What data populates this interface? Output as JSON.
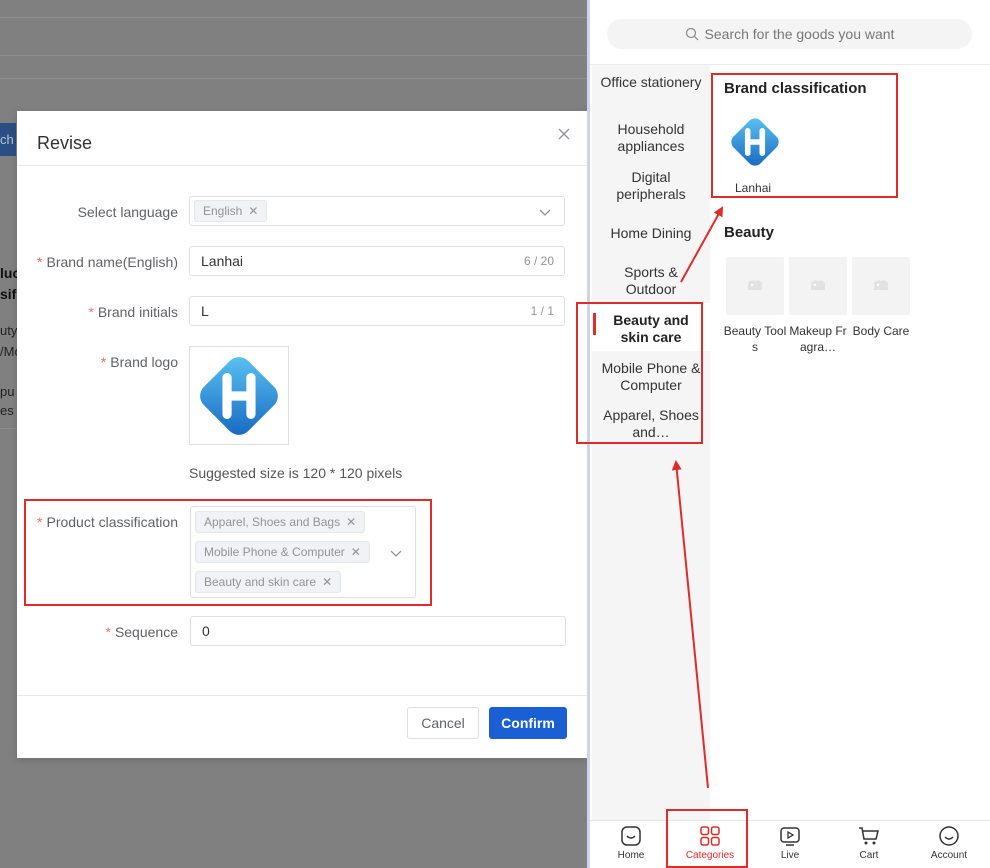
{
  "modal": {
    "title": "Revise",
    "language": {
      "label": "Select language",
      "tag": "English"
    },
    "brand_name": {
      "label": "Brand name(English)",
      "value": "Lanhai",
      "count": "6 / 20"
    },
    "brand_initials": {
      "label": "Brand initials",
      "value": "L",
      "count": "1 / 1"
    },
    "brand_logo": {
      "label": "Brand logo",
      "hint": "Suggested size is 120 * 120 pixels"
    },
    "product_classification": {
      "label": "Product classification",
      "tags": [
        "Apparel, Shoes and Bags",
        "Mobile Phone & Computer",
        "Beauty and skin care"
      ]
    },
    "sequence": {
      "label": "Sequence",
      "value": "0"
    },
    "buttons": {
      "cancel": "Cancel",
      "confirm": "Confirm"
    }
  },
  "backdrop": {
    "search_fragment": "ch",
    "fragments": [
      "luc",
      "sifi",
      "uty",
      "/Mo",
      "pu",
      "es a"
    ]
  },
  "mobile": {
    "search_placeholder": "Search for the goods you want",
    "categories": [
      "Office stationery",
      "Household appliances",
      "Digital peripherals",
      "Home Dining",
      "Sports & Outdoor",
      "Beauty and skin care",
      "Mobile Phone & Computer",
      "Apparel, Shoes and…"
    ],
    "active_category": "Beauty and skin care",
    "brand_section": {
      "title": "Brand classification",
      "brand": "Lanhai"
    },
    "beauty_section": {
      "title": "Beauty",
      "items": [
        "Beauty Tools",
        "Makeup Fragra…",
        "Body Care"
      ]
    },
    "tabs": [
      "Home",
      "Categories",
      "Live",
      "Cart",
      "Account"
    ],
    "active_tab": "Categories"
  },
  "colors": {
    "accent_red": "#e02b2b",
    "primary_blue": "#1a5fd4",
    "logo_blue": "#1e88e5",
    "required_star": "#f56c6c"
  }
}
